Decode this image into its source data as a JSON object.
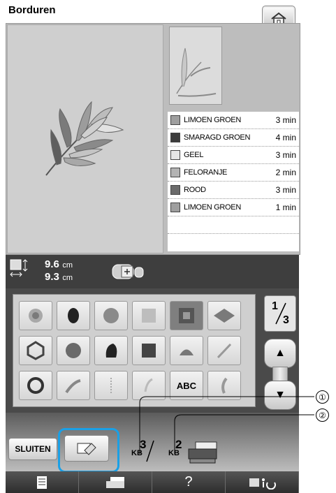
{
  "screen": {
    "title": "Borduren"
  },
  "thread_list": [
    {
      "name": "LIMOEN GROEN",
      "time": "3 min",
      "color": "#9e9e9e"
    },
    {
      "name": "SMARAGD GROEN",
      "time": "4 min",
      "color": "#3c3c3c"
    },
    {
      "name": "GEEL",
      "time": "3 min",
      "color": "#e6e6e6"
    },
    {
      "name": "FELORANJE",
      "time": "2 min",
      "color": "#b3b3b3"
    },
    {
      "name": "ROOD",
      "time": "3 min",
      "color": "#6a6a6a"
    },
    {
      "name": "LIMOEN GROEN",
      "time": "1 min",
      "color": "#9e9e9e"
    }
  ],
  "size": {
    "width_value": "9.6",
    "height_value": "9.3",
    "unit": "cm"
  },
  "pattern_grid": {
    "page_current": "1",
    "page_total": "3",
    "abc_label": "ABC"
  },
  "actions": {
    "close_label": "SLUITEN",
    "memory_pattern_num": "3",
    "memory_machine_num": "2",
    "memory_unit": "KB"
  },
  "callouts": [
    "①",
    "②"
  ],
  "colors": {
    "highlight": "#1aa0e6"
  }
}
